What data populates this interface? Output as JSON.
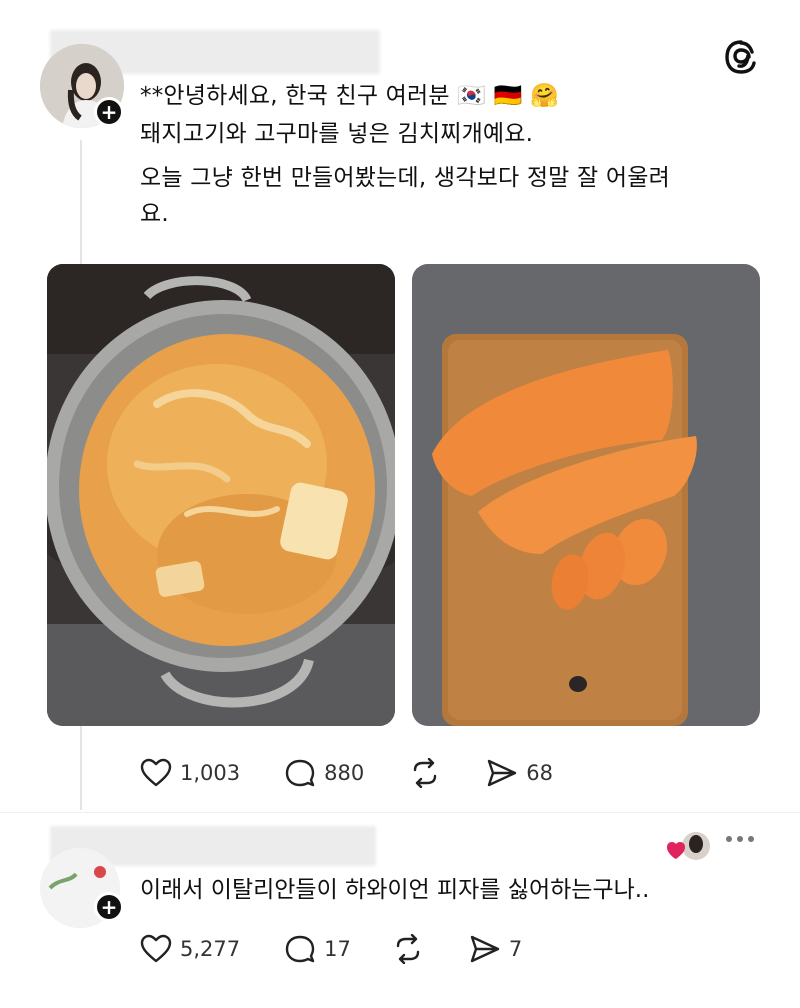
{
  "post": {
    "text_lines": [
      "**안녕하세요, 한국 친구 여러분 🇰🇷 🇩🇪 🤗",
      "돼지고기와 고구마를 넣은 김치찌개예요.",
      "오늘 그냥 한번 만들어봤는데, 생각보다 정말 잘 어울려",
      "요."
    ],
    "stats": {
      "likes": "1,003",
      "comments": "880",
      "shares": "68"
    }
  },
  "reply": {
    "text": "이래서 이탈리안들이 하와이언 피자를 싫어하는구나..",
    "stats": {
      "likes": "5,277",
      "comments": "17",
      "shares": "7"
    }
  },
  "icons": {
    "app_logo": "threads-icon",
    "like": "heart-icon",
    "comment": "comment-icon",
    "repost": "repost-icon",
    "share": "send-icon",
    "more": "more-icon",
    "follow": "plus-icon"
  },
  "colors": {
    "text": "#111111",
    "muted": "#333333",
    "divider": "#e4e4e4",
    "like_red": "#e0245e"
  }
}
